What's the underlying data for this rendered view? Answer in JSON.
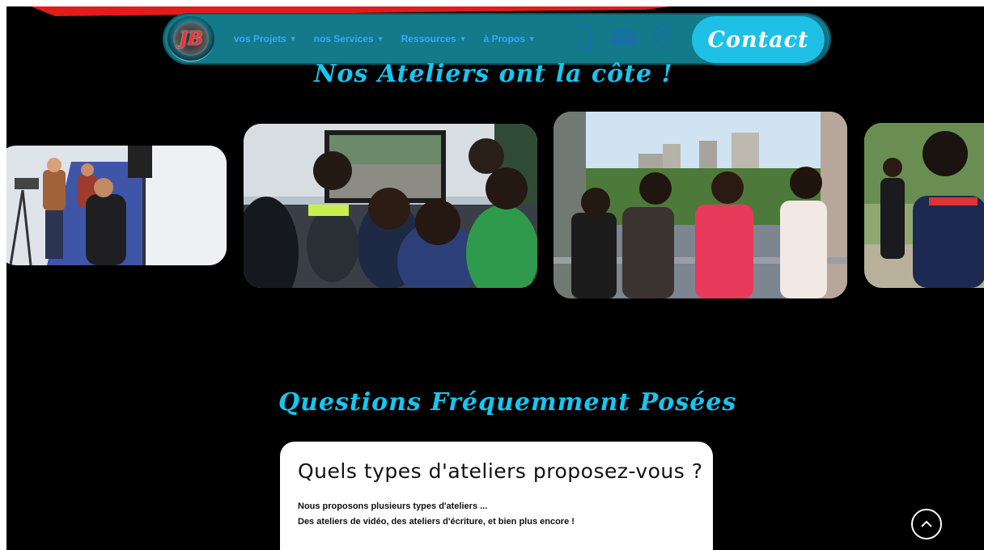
{
  "header": {
    "logo_text": "JB",
    "menu": [
      {
        "label": "vos Projets"
      },
      {
        "label": "nos Services"
      },
      {
        "label": "Ressources"
      },
      {
        "label": "à Propos"
      }
    ],
    "contact_label": "Contact",
    "icons": [
      "phone-icon",
      "email-icon",
      "location-icon"
    ]
  },
  "ateliers": {
    "title": "Nos Ateliers ont la côte !"
  },
  "faq": {
    "title": "Questions Fréquemment Posées",
    "question": "Quels types d'ateliers proposez-vous ?",
    "answer_line1": "Nous proposons plusieurs types d'ateliers ...",
    "answer_line2": "Des ateliers de vidéo, des ateliers d'écriture, et bien plus encore !"
  },
  "colors": {
    "accent": "#16c6f0",
    "nav_bg": "#137a8a",
    "menu_text": "#3aa6ff",
    "background": "#000000"
  }
}
